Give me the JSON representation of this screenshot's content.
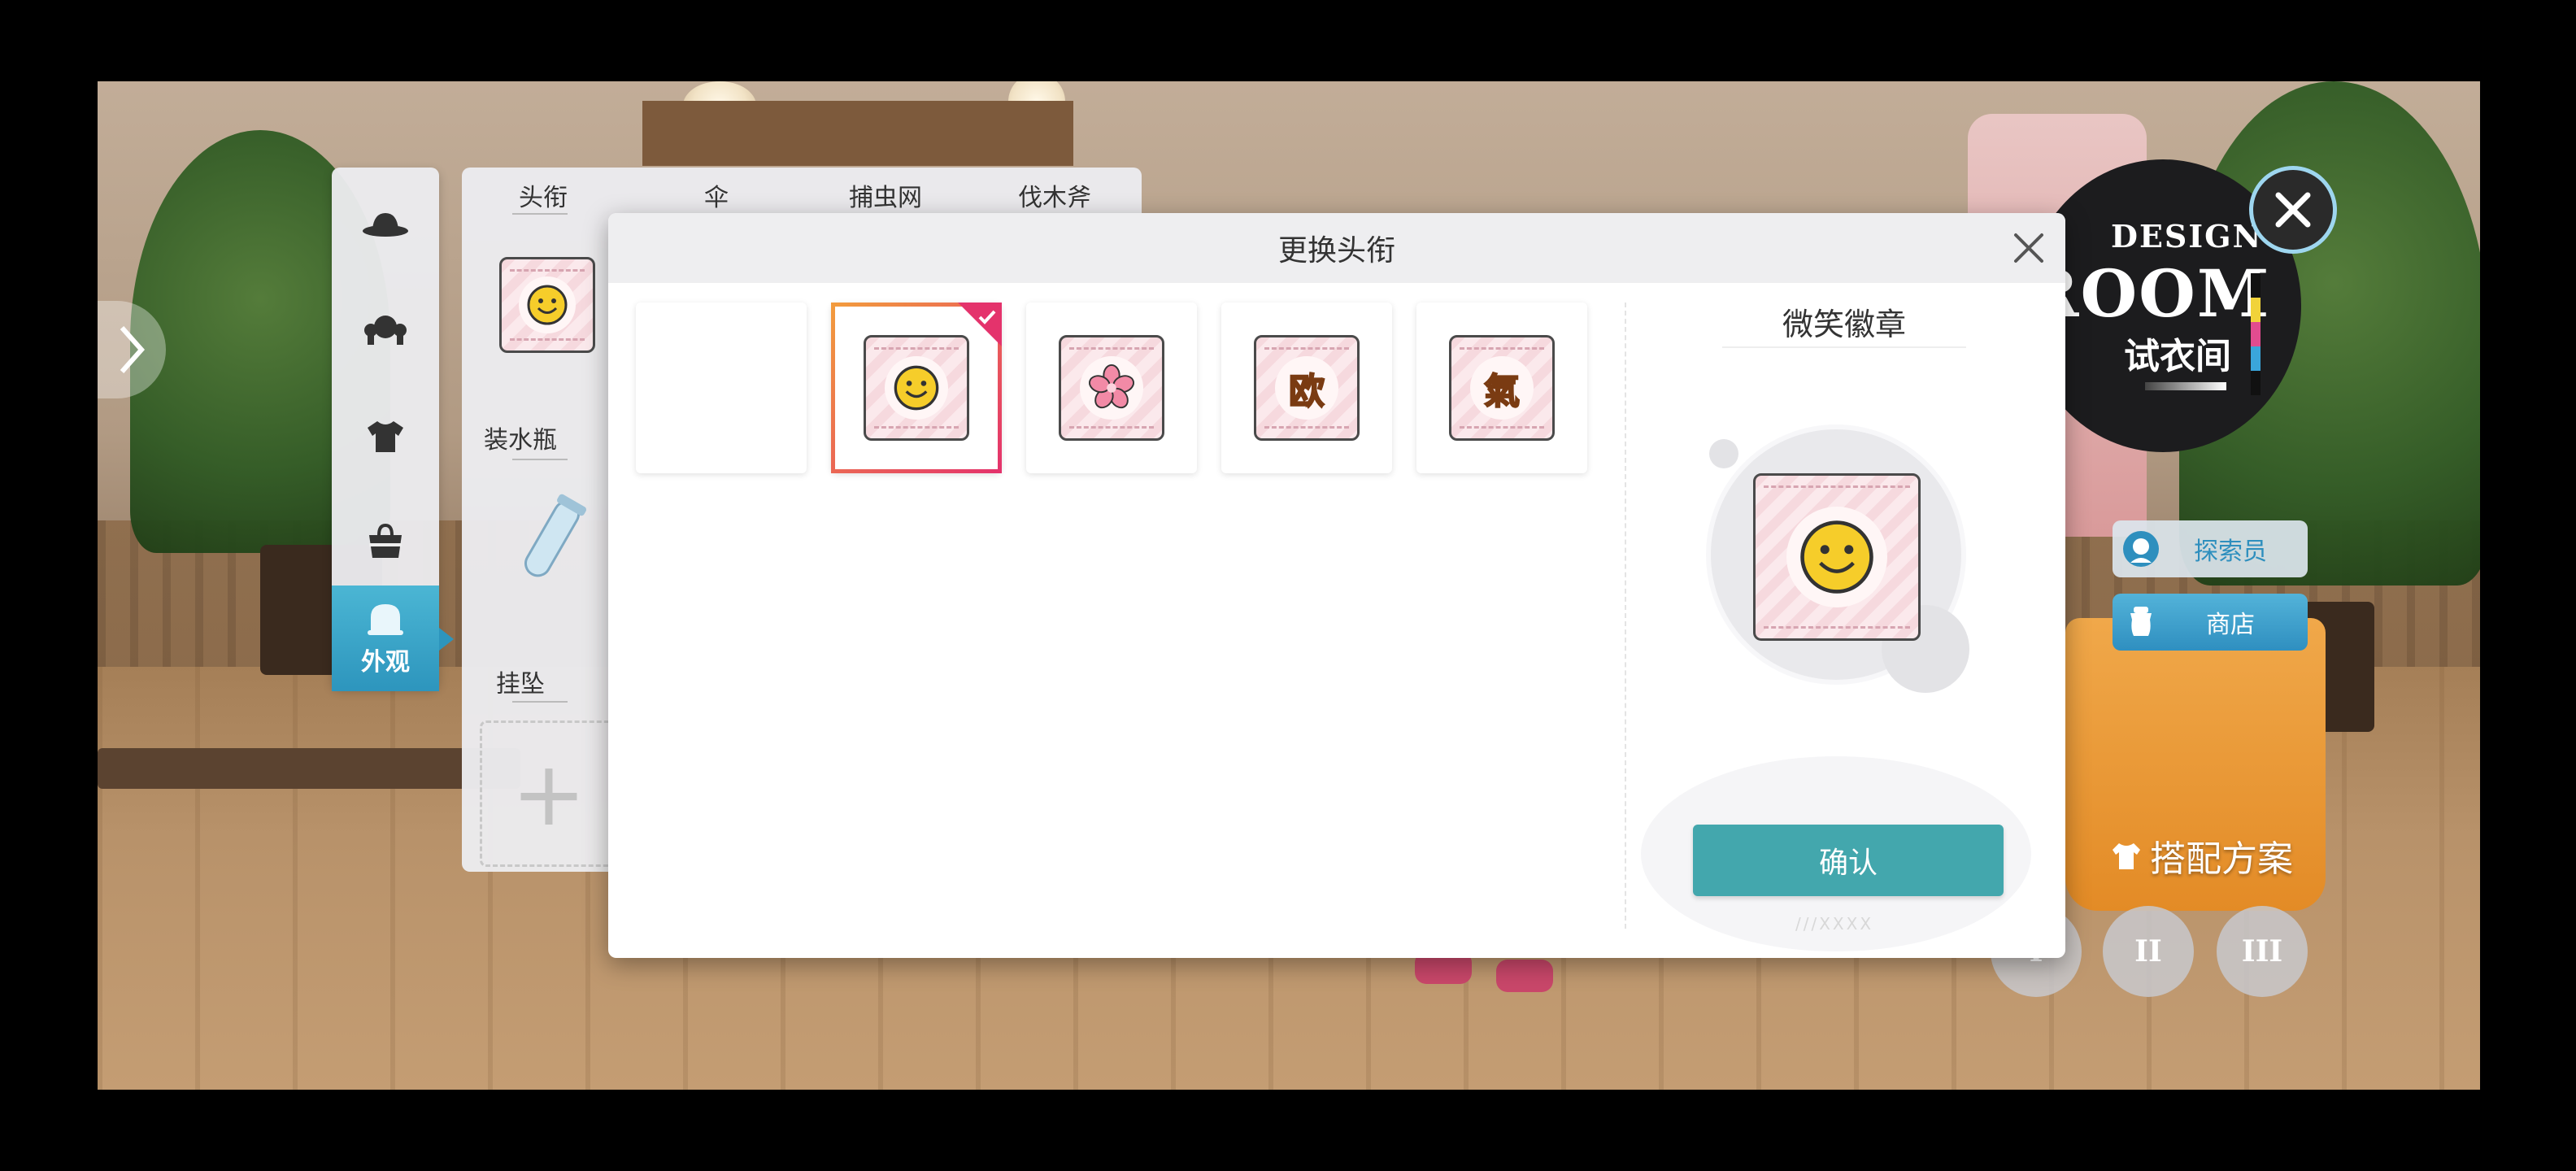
{
  "nav": {
    "items": [
      {
        "icon": "hat-icon"
      },
      {
        "icon": "hair-icon"
      },
      {
        "icon": "shirt-icon"
      },
      {
        "icon": "bag-icon"
      }
    ],
    "active_label": "外观"
  },
  "equip_panel": {
    "tabs": [
      "头衔",
      "伞",
      "捕虫网",
      "伐木斧"
    ],
    "slot_labels": [
      "装水瓶",
      "挂坠"
    ],
    "add_symbol": "+"
  },
  "modal": {
    "title": "更换头衔",
    "items": [
      {
        "label": "",
        "icon": "empty"
      },
      {
        "label": "",
        "icon": "smile-face-icon",
        "selected": true
      },
      {
        "label": "",
        "icon": "sakura-flower-icon"
      },
      {
        "label": "欧",
        "icon": "ou-character-badge"
      },
      {
        "label": "氣",
        "icon": "qi-character-badge"
      }
    ],
    "detail": {
      "name": "微笑徽章",
      "deco": "///XXXX"
    },
    "confirm_label": "确认"
  },
  "hud": {
    "logo": {
      "line1": "DESIGN",
      "line2": "ROOM",
      "line3": "试衣间"
    },
    "explorer_label": "探索员",
    "shop_label": "商店",
    "outfit_plan_label": "搭配方案",
    "pose_buttons": [
      "I",
      "II",
      "III"
    ]
  },
  "colors": {
    "accent": "#43a7ad",
    "nav_active": "#2d95bd",
    "selected_border_start": "#f29b3d",
    "selected_border_end": "#e4336c"
  }
}
